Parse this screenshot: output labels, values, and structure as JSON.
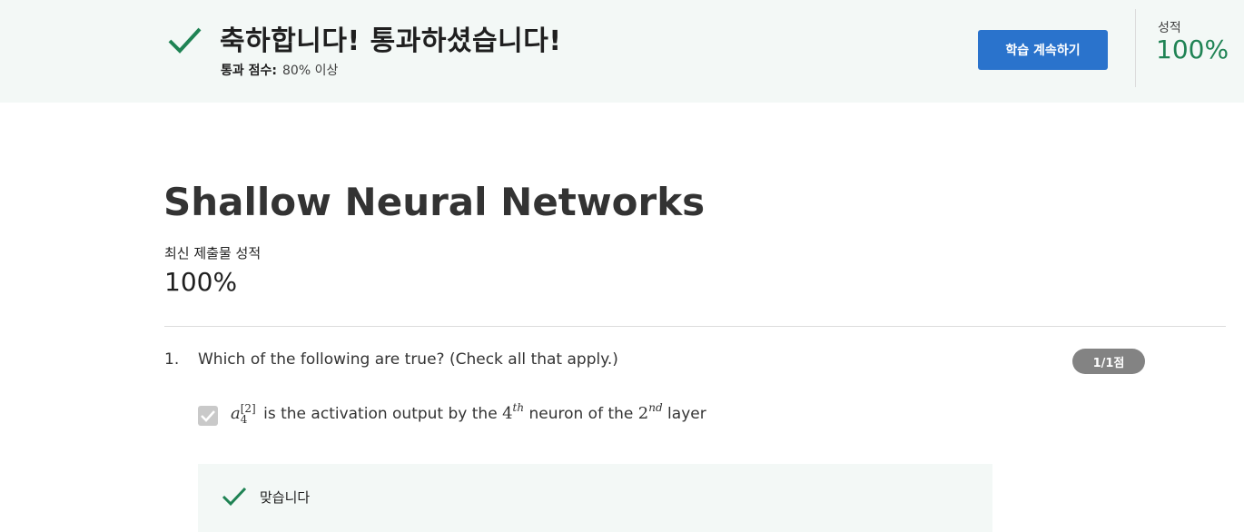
{
  "banner": {
    "title": "축하합니다! 통과하셨습니다!",
    "pass_label": "통과 점수:",
    "pass_value": "80% 이상",
    "continue_button": "학습 계속하기",
    "grade_label": "성적",
    "grade_value": "100%",
    "accent_color": "#1f8354",
    "button_color": "#2a73cc"
  },
  "quiz": {
    "title": "Shallow Neural Networks",
    "latest_label": "최신 제출물 성적",
    "latest_value": "100%"
  },
  "question": {
    "number": "1.",
    "text": "Which of the following are true? (Check all that apply.)",
    "score": "1/1점",
    "option": {
      "checked": true,
      "var": "a",
      "sup": "[2]",
      "sub": "4",
      "text1": " is the activation output by the ",
      "num1": "4",
      "sup1": "th",
      "text2": " neuron of the ",
      "num2": "2",
      "sup2": "nd",
      "text3": " layer"
    },
    "feedback": "맞습니다"
  },
  "icons": {
    "banner_check": "check-icon",
    "option_check": "checkbox-checked-icon",
    "feedback_check": "check-icon"
  }
}
